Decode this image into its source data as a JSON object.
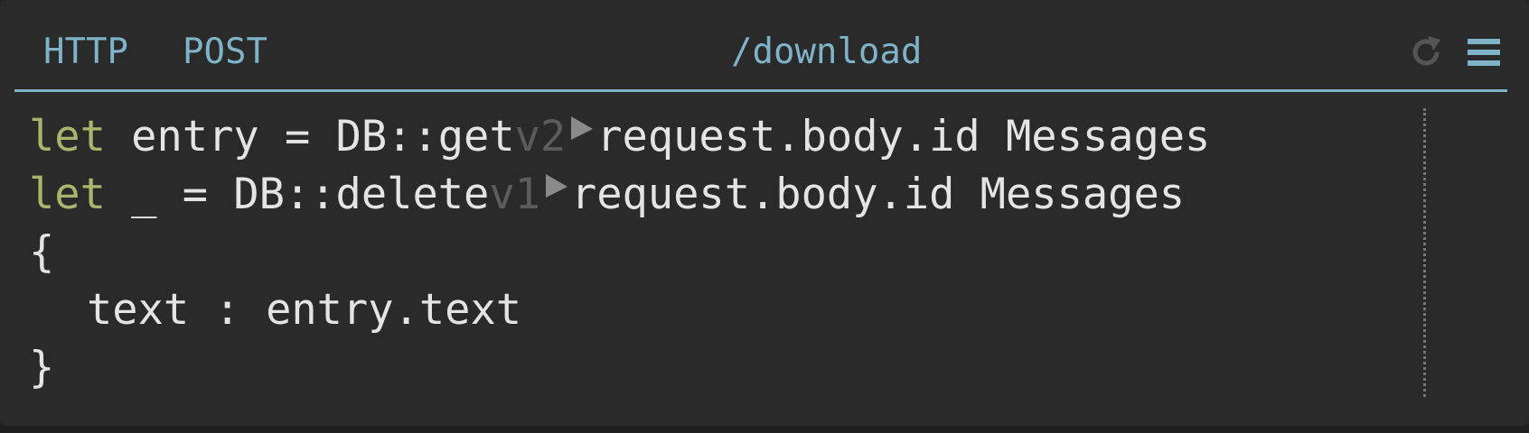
{
  "header": {
    "handler_type": "HTTP",
    "method": "POST",
    "path": "/download",
    "accent_color": "#7fb3c8",
    "refresh_icon": "refresh-icon",
    "menu_icon": "hamburger-menu-icon"
  },
  "code": {
    "line1": {
      "keyword": "let",
      "binding": " entry = ",
      "fn": "DB::get",
      "version": "v2",
      "args": "request.body.id Messages"
    },
    "line2": {
      "keyword": "let",
      "binding": " _ = ",
      "fn": "DB::delete",
      "version": "v1",
      "args": "request.body.id Messages"
    },
    "line3": "{",
    "line4": {
      "field": "text",
      "sep": " : ",
      "value": "entry.text"
    },
    "line5": "}",
    "keyword_color": "#a7b66b",
    "version_color": "#5c5c5c"
  }
}
